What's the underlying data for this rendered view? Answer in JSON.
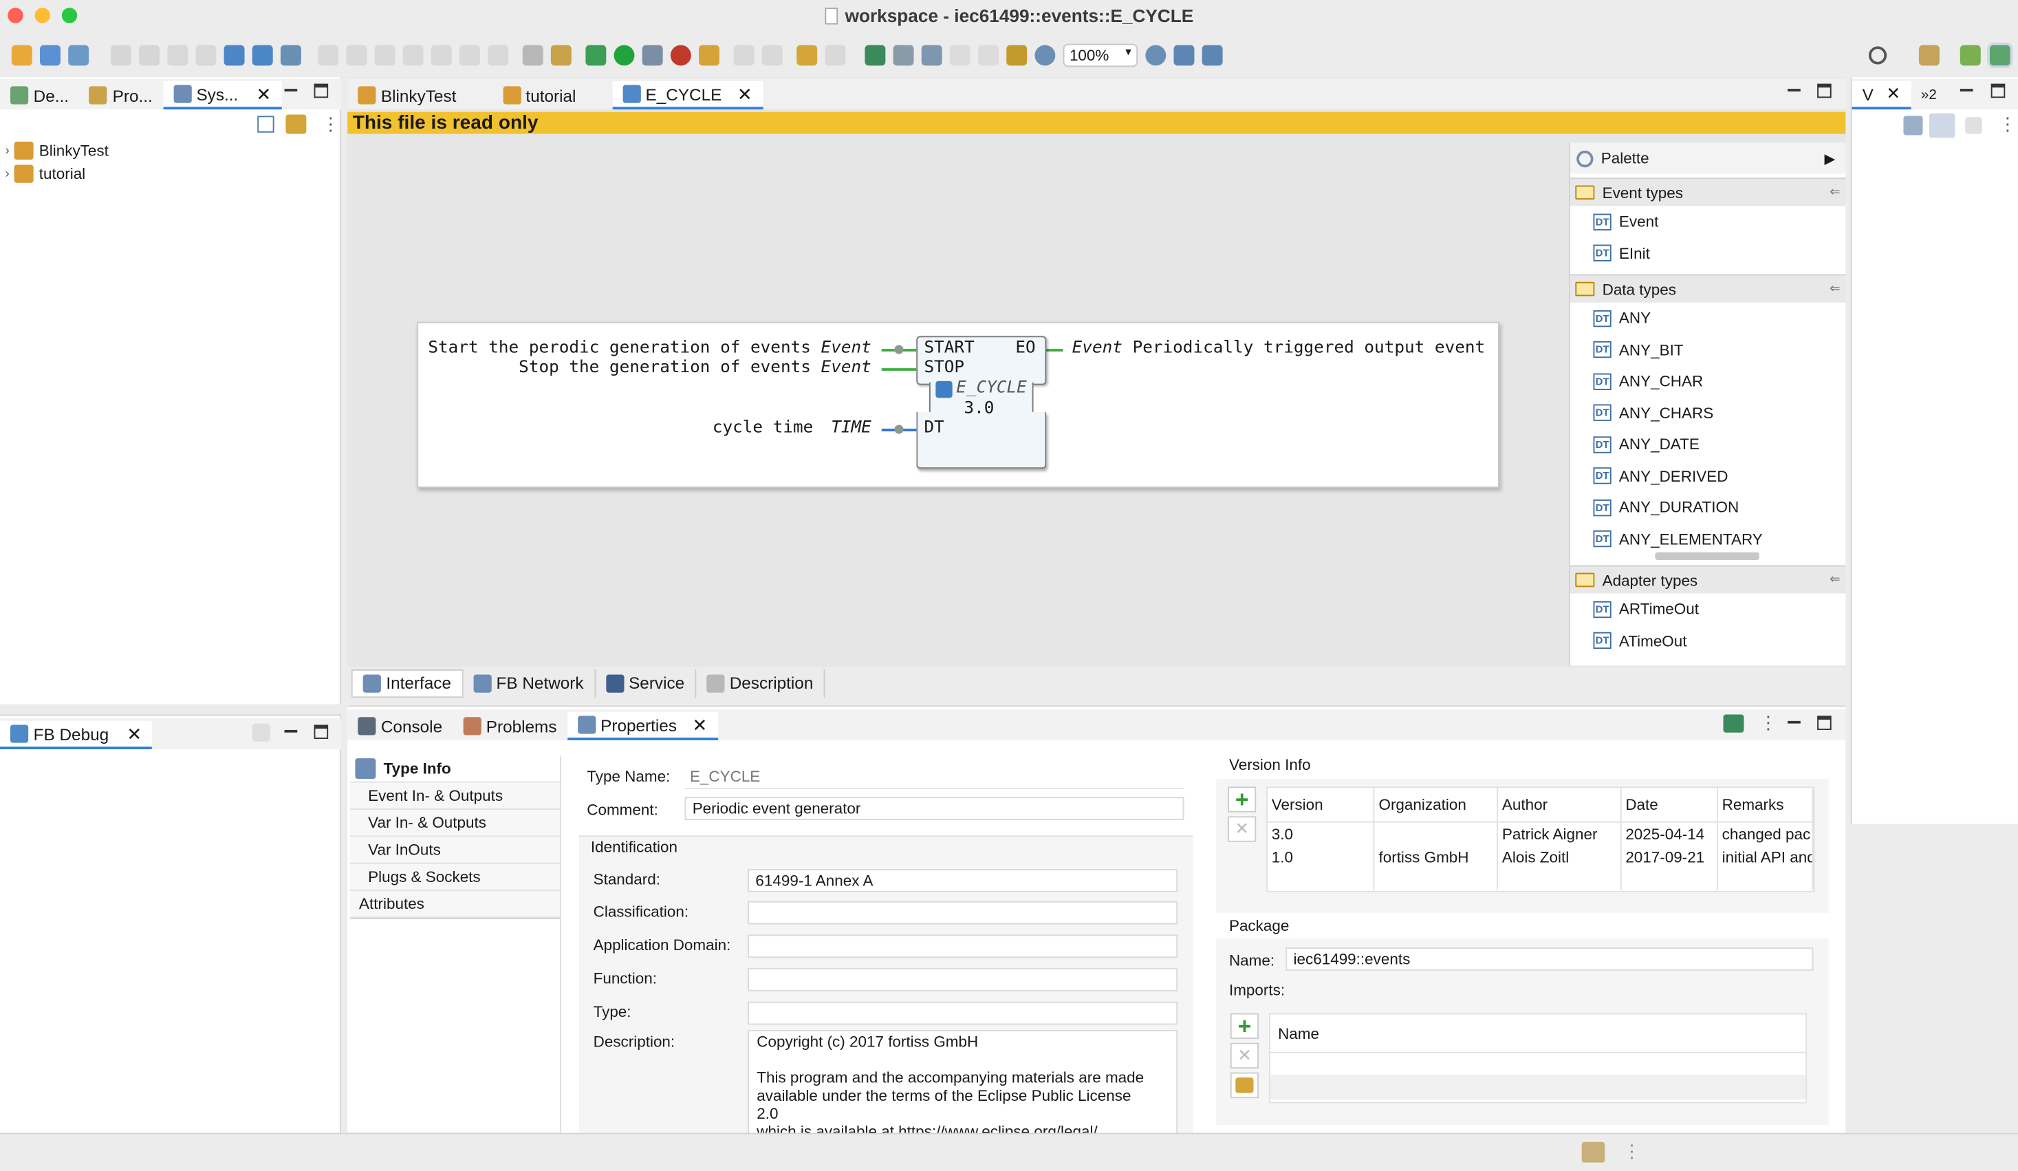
{
  "window": {
    "title": "workspace - iec61499::events::E_CYCLE"
  },
  "colors": {
    "accent": "#2f7ed8",
    "readonly_banner": "#f2c12e",
    "canvas": "#e6e6e6",
    "event_line": "#3cae3c",
    "data_line": "#2f6fd8"
  },
  "toolbar": {
    "zoom": "100%"
  },
  "left_tabs": [
    {
      "label": "De..."
    },
    {
      "label": "Pro..."
    },
    {
      "label": "Sys..."
    }
  ],
  "tree": [
    {
      "label": "BlinkyTest"
    },
    {
      "label": "tutorial"
    }
  ],
  "editor_tabs": [
    {
      "label": "BlinkyTest"
    },
    {
      "label": "tutorial"
    },
    {
      "label": "E_CYCLE"
    }
  ],
  "banner": {
    "text": "This file is read only"
  },
  "fb": {
    "name": "E_CYCLE",
    "version": "3.0",
    "inputs": [
      {
        "name": "START",
        "type": "Event",
        "comment": "Start the perodic generation of events"
      },
      {
        "name": "STOP",
        "type": "Event",
        "comment": "Stop the generation of events"
      },
      {
        "name": "DT",
        "type": "TIME",
        "comment": "cycle time"
      }
    ],
    "outputs": [
      {
        "name": "EO",
        "type": "Event",
        "comment": "Periodically triggered output event"
      }
    ]
  },
  "palette": {
    "title": "Palette",
    "groups": [
      {
        "label": "Event types",
        "items": [
          "Event",
          "EInit"
        ]
      },
      {
        "label": "Data types",
        "items": [
          "ANY",
          "ANY_BIT",
          "ANY_CHAR",
          "ANY_CHARS",
          "ANY_DATE",
          "ANY_DERIVED",
          "ANY_DURATION",
          "ANY_ELEMENTARY"
        ]
      },
      {
        "label": "Adapter types",
        "items": [
          "ARTimeOut",
          "ATimeOut"
        ]
      }
    ]
  },
  "editor_bottom_tabs": [
    {
      "label": "Interface"
    },
    {
      "label": "FB Network"
    },
    {
      "label": "Service"
    },
    {
      "label": "Description"
    }
  ],
  "fbdebug": {
    "label": "FB Debug"
  },
  "bottom_tabs": [
    {
      "label": "Console"
    },
    {
      "label": "Problems"
    },
    {
      "label": "Properties"
    }
  ],
  "props": {
    "sections": [
      "Type Info",
      "Event In- & Outputs",
      "Var In- & Outputs",
      "Var InOuts",
      "Plugs & Sockets",
      "Attributes"
    ],
    "type_name_label": "Type Name:",
    "type_name": "E_CYCLE",
    "comment_label": "Comment:",
    "comment": "Periodic event generator",
    "identification": "Identification",
    "standard_label": "Standard:",
    "standard": "61499-1 Annex A",
    "classification_label": "Classification:",
    "appdomain_label": "Application Domain:",
    "function_label": "Function:",
    "type_label": "Type:",
    "description_label": "Description:",
    "description_lines": [
      "Copyright (c) 2017 fortiss GmbH",
      "",
      "This program and the accompanying materials are made",
      "available under the terms of the Eclipse Public License",
      "2.0",
      "which is available at https://www.eclipse.org/legal/"
    ],
    "version_info": "Version Info",
    "version_headers": [
      "Version",
      "Organization",
      "Author",
      "Date",
      "Remarks"
    ],
    "versions": [
      [
        "3.0",
        "",
        "Patrick Aigner",
        "2025-04-14",
        "changed pac"
      ],
      [
        "1.0",
        "fortiss GmbH",
        "Alois Zoitl",
        "2017-09-21",
        "initial API and"
      ]
    ],
    "package": "Package",
    "name_label": "Name:",
    "package_name": "iec61499::events",
    "imports_label": "Imports:",
    "imports_header": "Name"
  },
  "right_panel": {
    "tab": "V",
    "overflow": "»2"
  }
}
